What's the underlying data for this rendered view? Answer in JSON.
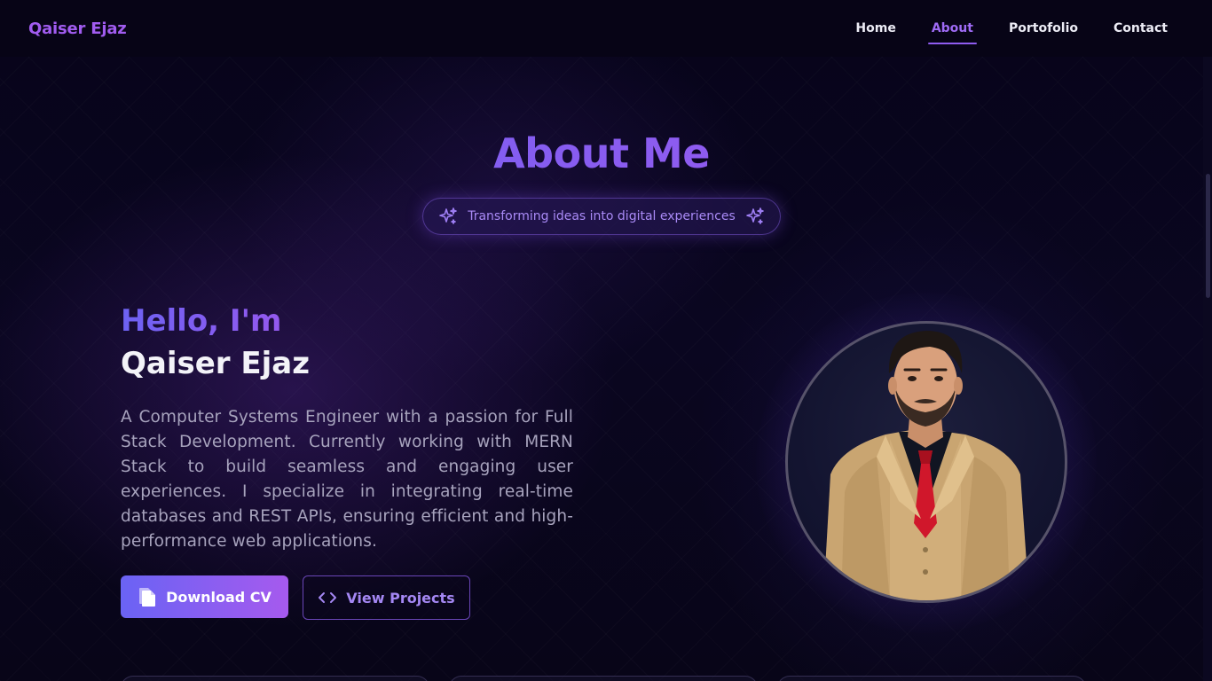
{
  "nav": {
    "brand": "Qaiser Ejaz",
    "links": [
      {
        "label": "Home",
        "active": false
      },
      {
        "label": "About",
        "active": true
      },
      {
        "label": "Portofolio",
        "active": false
      },
      {
        "label": "Contact",
        "active": false
      }
    ]
  },
  "hero": {
    "title": "About Me",
    "tagline": "Transforming ideas into digital experiences",
    "tagline_icon": "sparkle-icon"
  },
  "intro": {
    "hello": "Hello, I'm",
    "name": "Qaiser Ejaz",
    "bio": "A Computer Systems Engineer with a passion for Full Stack Development. Currently working with MERN Stack to build seamless and engaging user experiences. I specialize in integrating real-time databases and REST APIs, ensuring efficient and high-performance web applications."
  },
  "buttons": {
    "download_cv": {
      "label": "Download CV",
      "icon": "document-icon"
    },
    "view_projects": {
      "label": "View Projects",
      "icon": "code-icon"
    }
  },
  "colors": {
    "accent": "#8f5cf0",
    "accent_blue": "#6a63f4",
    "accent_pink": "#a65aee",
    "background": "#07041a"
  }
}
